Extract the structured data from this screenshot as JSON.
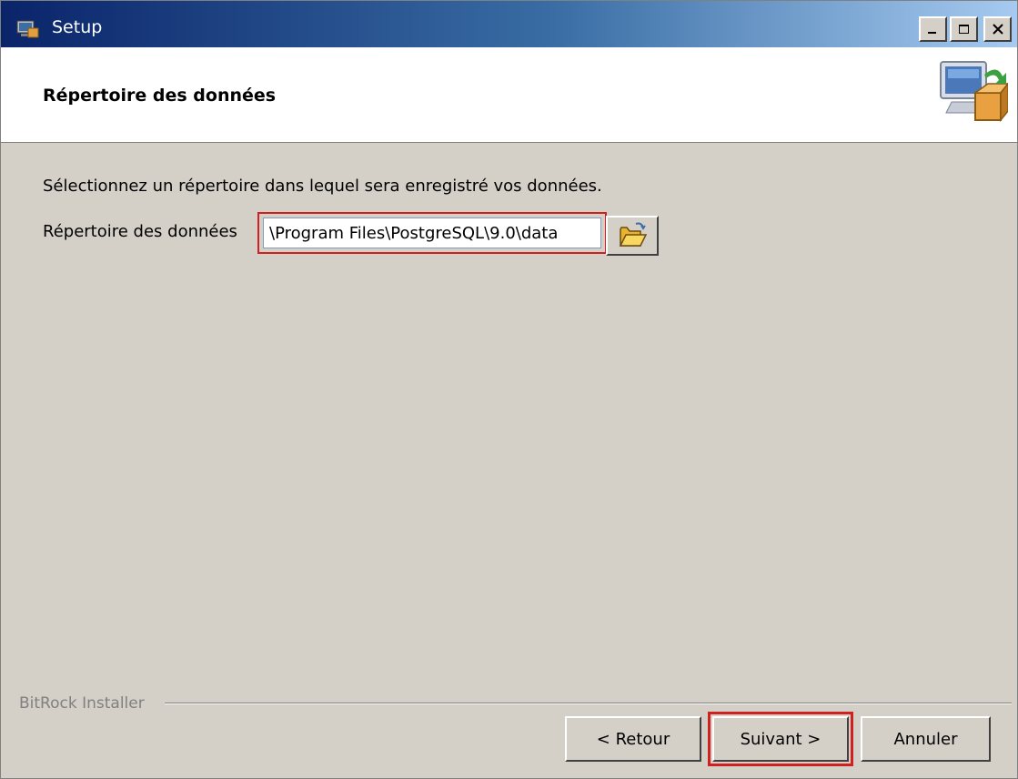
{
  "window": {
    "title": "Setup"
  },
  "header": {
    "title": "Répertoire des données"
  },
  "body": {
    "instruction": "Sélectionnez un répertoire dans lequel sera enregistré vos données.",
    "data_dir_label": "Répertoire des données",
    "data_dir_value": "\\Program Files\\PostgreSQL\\9.0\\data"
  },
  "footer": {
    "brand": "BitRock Installer",
    "back_label": "< Retour",
    "next_label": "Suivant >",
    "cancel_label": "Annuler"
  },
  "icons": {
    "app": "setup-app-icon",
    "header": "computer-install-icon",
    "browse": "folder-open-icon"
  },
  "colors": {
    "highlight": "#d02020",
    "titlebar_start": "#0a246a",
    "titlebar_end": "#a6caf0",
    "face": "#d4d0c8"
  }
}
